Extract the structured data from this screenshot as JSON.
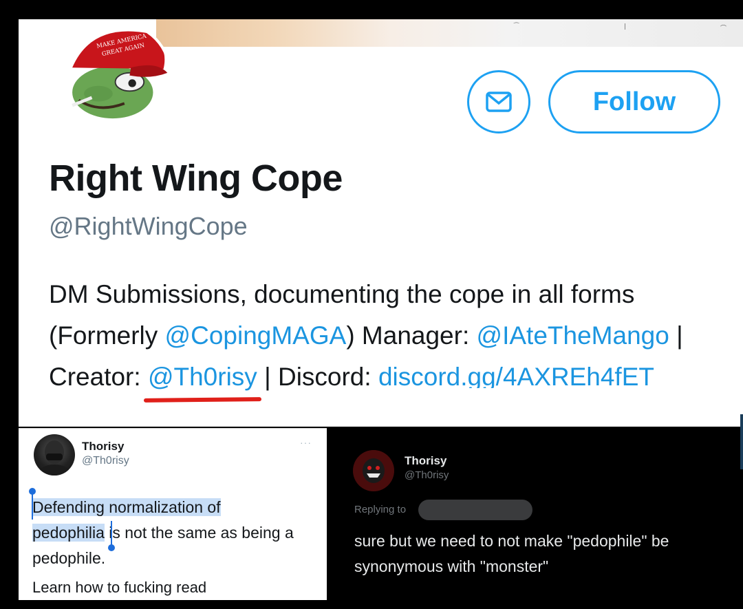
{
  "profile": {
    "display_name": "Right Wing Cope",
    "handle": "@RightWingCope",
    "message_button_icon": "mail-icon",
    "follow_label": "Follow",
    "avatar_hat_text_1": "MAKE AMERICA",
    "avatar_hat_text_2": "GREAT AGAIN",
    "bio": {
      "part1": "DM Submissions, documenting the cope in all forms (Formerly ",
      "link_former": "@CopingMAGA",
      "part2": ") Manager: ",
      "link_manager": "@IAteTheMango",
      "part3": " | Creator: ",
      "link_creator": "@Th0risy",
      "part4": " | Discord: ",
      "link_discord": "discord.gg/4AXREh4fET"
    }
  },
  "tweet_left": {
    "name": "Thorisy",
    "handle": "@Th0risy",
    "more": "···",
    "highlight_1": "Defending normalization of",
    "highlight_2": "pedophilia",
    "text_rest": " is not the same as being a pedophile.",
    "text_2": "Learn how to fucking read"
  },
  "tweet_right": {
    "name": "Thorisy",
    "handle": "@Th0risy",
    "replying_to": "Replying to",
    "text": "sure but we need to not make \"pedophile\" be synonymous with \"monster\""
  },
  "colors": {
    "twitter_blue": "#1da1f2",
    "link_blue": "#1b95e0",
    "underline_red": "#e0201a",
    "selection": "#c7ddf6",
    "hat_red": "#c8151b",
    "pepe_green": "#5f9a4a"
  }
}
